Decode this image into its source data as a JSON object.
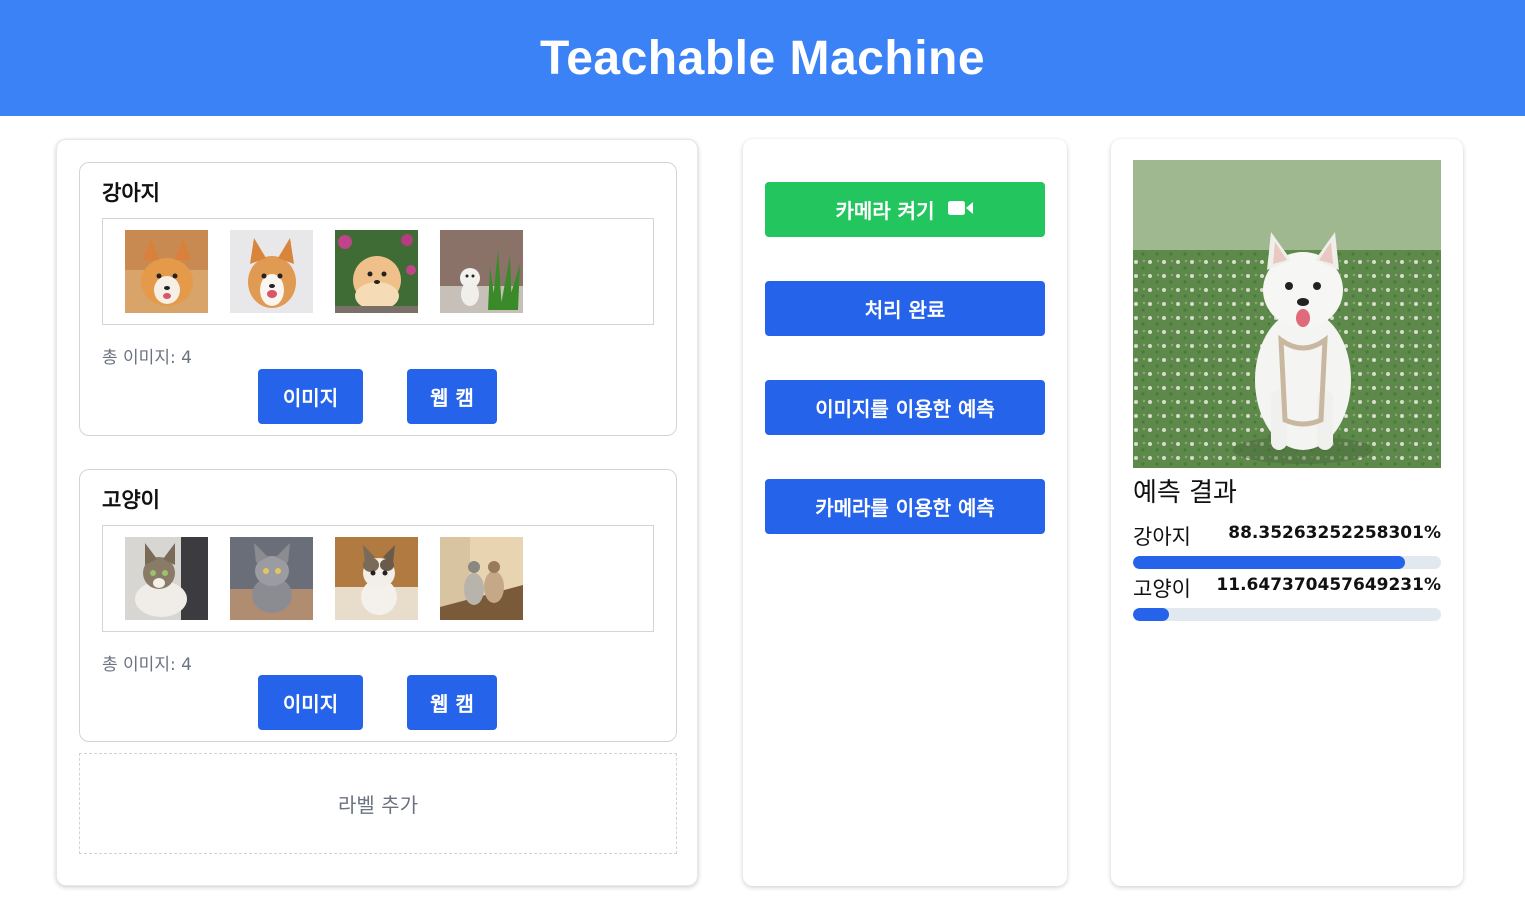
{
  "header": {
    "title": "Teachable Machine",
    "bg_color": "#3b82f6"
  },
  "labels": [
    {
      "name": "강아지",
      "count_text": "총 이미지: 4",
      "image_button": "이미지",
      "webcam_button": "웹 캠",
      "thumbnails": [
        "corgi-1",
        "corgi-2",
        "pomeranian",
        "dog-in-grass"
      ]
    },
    {
      "name": "고양이",
      "count_text": "총 이미지: 4",
      "image_button": "이미지",
      "webcam_button": "웹 캠",
      "thumbnails": [
        "tabby-cat",
        "grey-kitten",
        "calico-kitten",
        "two-cats"
      ]
    }
  ],
  "add_label": "라벨 추가",
  "controls": {
    "camera_on": "카메라 켜기",
    "camera_icon": "video-camera-icon",
    "finish": "처리 완료",
    "predict_image": "이미지를 이용한 예측",
    "predict_camera": "카메라를 이용한 예측",
    "camera_on_color": "#22c55e",
    "primary_color": "#2563eb"
  },
  "prediction": {
    "title": "예측 결과",
    "results": [
      {
        "label": "강아지",
        "percent_text": "88.35263252258301%",
        "value": 0.8835
      },
      {
        "label": "고양이",
        "percent_text": "11.647370457649231%",
        "value": 0.1165
      }
    ]
  }
}
